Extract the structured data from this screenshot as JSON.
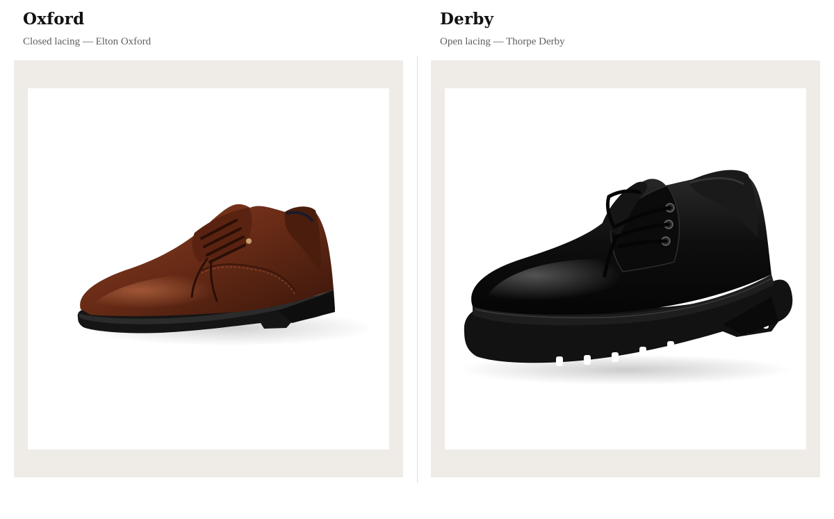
{
  "comparison": {
    "left": {
      "style": "Oxford",
      "caption": "Closed lacing — Elton Oxford",
      "image_icon": "brown-oxford-shoe-icon"
    },
    "right": {
      "style": "Derby",
      "caption": "Open lacing — Thorpe Derby",
      "image_icon": "black-derby-shoe-icon"
    }
  },
  "colors": {
    "frame": "#efebe6",
    "title": "#111111",
    "caption": "#5f5f5f",
    "oxford_leather": "#6a2c17",
    "derby_leather": "#0c0c0c"
  }
}
